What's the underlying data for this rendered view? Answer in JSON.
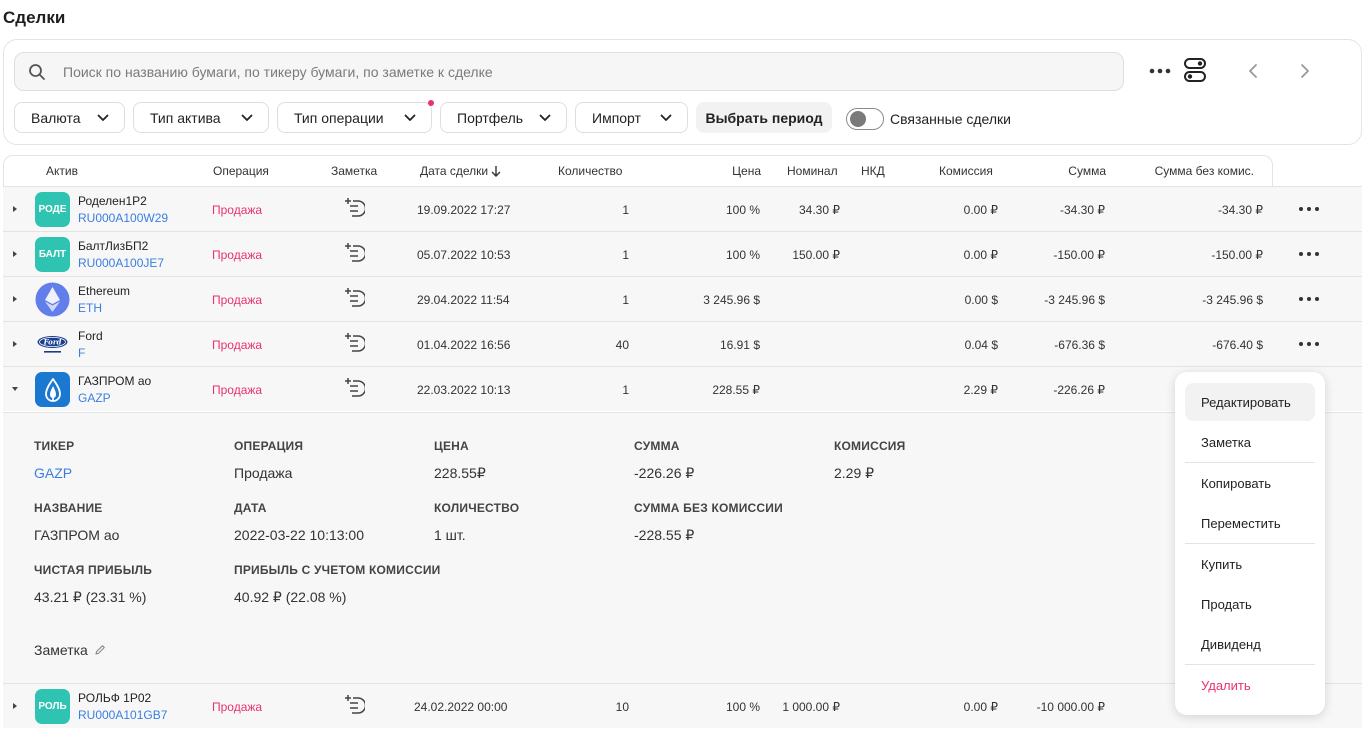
{
  "page": {
    "title": "Сделки"
  },
  "search": {
    "placeholder": "Поиск по названию бумаги, по тикеру бумаги, по заметке к сделке"
  },
  "filters": {
    "currency": "Валюта",
    "asset_type": "Тип актива",
    "operation_type": "Тип операции",
    "portfolio": "Портфель",
    "import": "Импорт",
    "period": "Выбрать период",
    "linked_deals": "Связанные сделки",
    "linked_deals_on": false
  },
  "table": {
    "headers": {
      "asset": "Актив",
      "operation": "Операция",
      "note": "Заметка",
      "date": "Дата сделки",
      "quantity": "Количество",
      "price": "Цена",
      "nominal": "Номинал",
      "nkd": "НКД",
      "commission": "Комиссия",
      "sum": "Сумма",
      "sum_no_commission": "Сумма без комис."
    },
    "rows": [
      {
        "logo_text": "РОДЕ",
        "name": "Роделен1Р2",
        "ticker": "RU000A100W29",
        "operation": "Продажа",
        "date": "19.09.2022 17:27",
        "quantity": "1",
        "price": "100 %",
        "nominal": "34.30 ₽",
        "nkd": "",
        "commission": "0.00 ₽",
        "sum": "-34.30 ₽",
        "sum_no_commission": "-34.30 ₽"
      },
      {
        "logo_text": "БАЛТ",
        "name": "БалтЛизБП2",
        "ticker": "RU000A100JE7",
        "operation": "Продажа",
        "date": "05.07.2022 10:53",
        "quantity": "1",
        "price": "100 %",
        "nominal": "150.00 ₽",
        "nkd": "",
        "commission": "0.00 ₽",
        "sum": "-150.00 ₽",
        "sum_no_commission": "-150.00 ₽"
      },
      {
        "logo_text": "",
        "name": "Ethereum",
        "ticker": "ETH",
        "operation": "Продажа",
        "date": "29.04.2022 11:54",
        "quantity": "1",
        "price": "3 245.96 $",
        "nominal": "",
        "nkd": "",
        "commission": "0.00 $",
        "sum": "-3 245.96 $",
        "sum_no_commission": "-3 245.96 $"
      },
      {
        "logo_text": "Ford",
        "name": "Ford",
        "ticker": "F",
        "operation": "Продажа",
        "date": "01.04.2022 16:56",
        "quantity": "40",
        "price": "16.91 $",
        "nominal": "",
        "nkd": "",
        "commission": "0.04 $",
        "sum": "-676.36 $",
        "sum_no_commission": "-676.40 $"
      },
      {
        "logo_text": "",
        "name": "ГАЗПРОМ ао",
        "ticker": "GAZP",
        "operation": "Продажа",
        "date": "22.03.2022 10:13",
        "quantity": "1",
        "price": "228.55 ₽",
        "nominal": "",
        "nkd": "",
        "commission": "2.29 ₽",
        "sum": "-226.26 ₽",
        "sum_no_commission": ""
      },
      {
        "logo_text": "РОЛЬ",
        "name": "РОЛЬФ 1Р02",
        "ticker": "RU000A101GB7",
        "operation": "Продажа",
        "date": "24.02.2022 00:00",
        "quantity": "10",
        "price": "100 %",
        "nominal": "1 000.00 ₽",
        "nkd": "",
        "commission": "0.00 ₽",
        "sum": "-10 000.00 ₽",
        "sum_no_commission": ""
      }
    ]
  },
  "details": {
    "ticker_label": "ТИКЕР",
    "ticker": "GAZP",
    "operation_label": "ОПЕРАЦИЯ",
    "operation": "Продажа",
    "price_label": "ЦЕНА",
    "price": "228.55₽",
    "sum_label": "СУММА",
    "sum": "-226.26 ₽",
    "commission_label": "КОМИССИЯ",
    "commission": "2.29 ₽",
    "name_label": "НАЗВАНИЕ",
    "name": "ГАЗПРОМ ао",
    "date_label": "ДАТА",
    "date": "2022-03-22 10:13:00",
    "quantity_label": "КОЛИЧЕСТВО",
    "quantity": "1 шт.",
    "sum_no_comm_label": "СУММА БЕЗ КОМИССИИ",
    "sum_no_comm": "-228.55 ₽",
    "net_profit_label": "ЧИСТАЯ ПРИБЫЛЬ",
    "net_profit": "43.21 ₽ (23.31 %)",
    "profit_comm_label": "ПРИБЫЛЬ С УЧЕТОМ КОМИССИИ",
    "profit_comm": "40.92 ₽ (22.08 %)",
    "note_label": "Заметка"
  },
  "context_menu": {
    "edit": "Редактировать",
    "note": "Заметка",
    "copy": "Копировать",
    "move": "Переместить",
    "buy": "Купить",
    "sell": "Продать",
    "dividend": "Дивиденд",
    "delete": "Удалить"
  },
  "colors": {
    "accent": "#3a7fe0",
    "sell": "#e8336b",
    "teal_logo": "#2fc4b2",
    "gazprom": "#1a78d1",
    "eth": "#627eea"
  }
}
